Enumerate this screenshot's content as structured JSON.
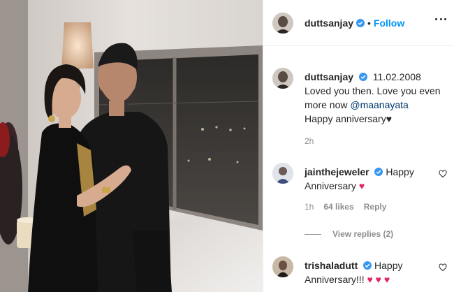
{
  "post": {
    "username": "duttsanjay",
    "verified": true,
    "separator": "•",
    "follow_label": "Follow",
    "more_icon": "more-options-icon"
  },
  "caption": {
    "username": "duttsanjay",
    "date": "11.02.2008",
    "line1": "Loved you then. Love you even more now ",
    "mention": "@maanayata",
    "line2": "Happy anniversary♥",
    "time": "2h"
  },
  "comments": [
    {
      "username": "jainthejeweler",
      "text": "Happy Anniversary",
      "emoji": "♥",
      "time": "1h",
      "likes": "64 likes",
      "reply_label": "Reply",
      "view_replies": "View replies (2)"
    },
    {
      "username": "trishaladutt",
      "text": "Happy Anniversary!!!",
      "emoji": "♥ ♥ ♥"
    }
  ],
  "colors": {
    "link_blue": "#0095f6",
    "mention": "#00376b",
    "verified": "#3897f0",
    "muted": "#8e8e8e",
    "heart_red": "#e0245e"
  }
}
